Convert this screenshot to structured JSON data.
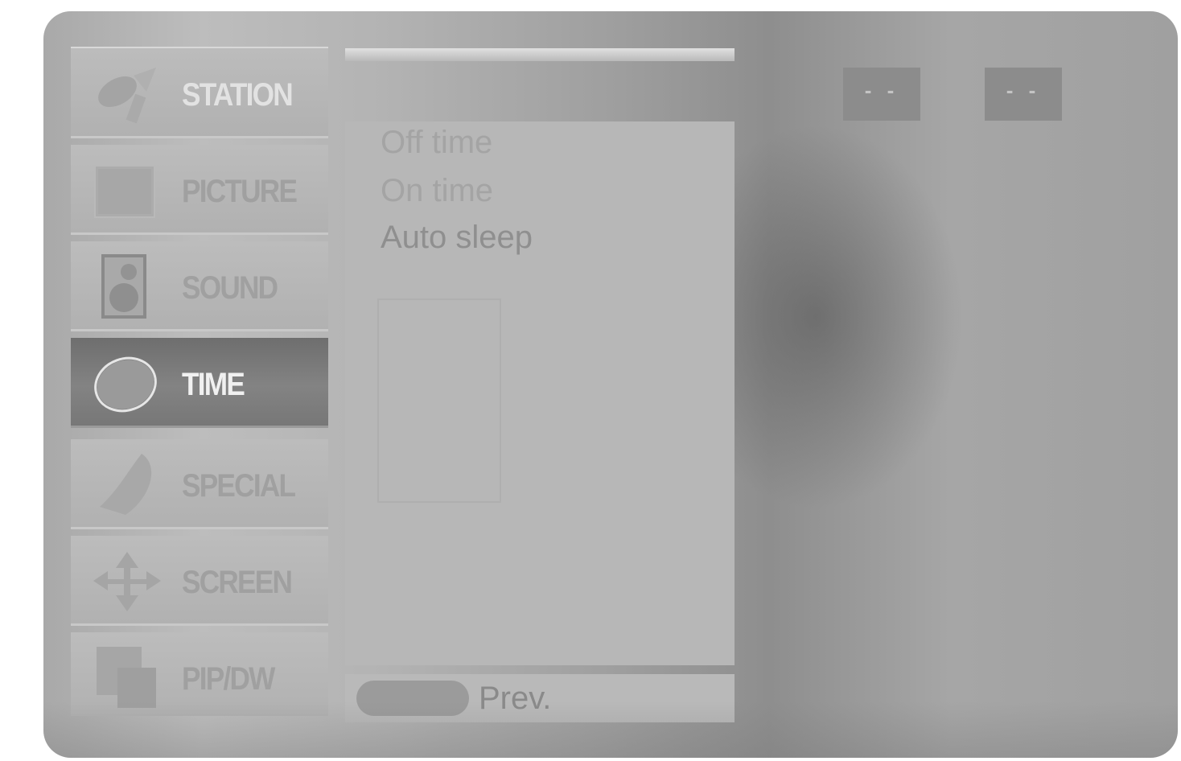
{
  "menu": {
    "items": [
      {
        "label": "STATION",
        "icon": "satellite-icon",
        "state": "normal"
      },
      {
        "label": "PICTURE",
        "icon": "picture-icon",
        "state": "normal"
      },
      {
        "label": "SOUND",
        "icon": "speaker-icon",
        "state": "normal"
      },
      {
        "label": "TIME",
        "icon": "clock-icon",
        "state": "selected"
      },
      {
        "label": "SPECIAL",
        "icon": "special-icon",
        "state": "normal"
      },
      {
        "label": "SCREEN",
        "icon": "screen-arrows-icon",
        "state": "normal"
      },
      {
        "label": "PIP/DW",
        "icon": "pip-icon",
        "state": "normal"
      }
    ]
  },
  "submenu": {
    "items": [
      {
        "label": "Off time"
      },
      {
        "label": "On time"
      },
      {
        "label": "Auto sleep"
      }
    ]
  },
  "footer": {
    "prev_label": "Prev."
  },
  "values": {
    "hour": "- -",
    "minute": "- -"
  }
}
